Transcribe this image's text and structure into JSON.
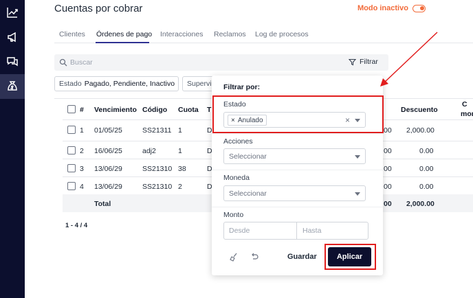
{
  "header": {
    "title": "Cuentas por cobrar",
    "mode_label": "Modo inactivo"
  },
  "sidebar": {
    "items": [
      {
        "icon": "chart-line-icon"
      },
      {
        "icon": "megaphone-icon"
      },
      {
        "icon": "chat-bubbles-icon"
      },
      {
        "icon": "money-bag-icon",
        "active": true
      }
    ]
  },
  "tabs": [
    "Clientes",
    "Órdenes de pago",
    "Interacciones",
    "Reclamos",
    "Log de procesos"
  ],
  "search": {
    "placeholder": "Buscar",
    "filter_label": "Filtrar"
  },
  "chips": [
    {
      "key": "Estado",
      "value": "Pagado, Pendiente, Inactivo"
    },
    {
      "key": "Supervis",
      "value": ""
    }
  ],
  "table": {
    "headers": [
      "#",
      "Vencimiento",
      "Código",
      "Cuota",
      "T",
      "Descuento",
      "C",
      "mon"
    ],
    "rows": [
      {
        "num": "1",
        "vencimiento": "01/05/25",
        "codigo": "SS21311",
        "cuota": "1",
        "t": "D",
        "partial": "00",
        "descuento": "2,000.00"
      },
      {
        "num": "2",
        "vencimiento": "16/06/25",
        "codigo": "adj2",
        "cuota": "1",
        "t": "D",
        "partial": "00",
        "descuento": "0.00"
      },
      {
        "num": "3",
        "vencimiento": "13/06/29",
        "codigo": "SS21310",
        "cuota": "38",
        "t": "D",
        "partial": "00",
        "descuento": "0.00"
      },
      {
        "num": "4",
        "vencimiento": "13/06/29",
        "codigo": "SS21310",
        "cuota": "2",
        "t": "D",
        "partial": "00",
        "descuento": "0.00"
      }
    ],
    "total_label": "Total",
    "total_partial": "00",
    "total_descuento": "2,000.00"
  },
  "pager": "1 - 4 / 4",
  "filter_panel": {
    "title": "Filtrar por:",
    "estado_label": "Estado",
    "estado_tag": "Anulado",
    "acciones_label": "Acciones",
    "acciones_placeholder": "Seleccionar",
    "moneda_label": "Moneda",
    "moneda_placeholder": "Seleccionar",
    "monto_label": "Monto",
    "desde_placeholder": "Desde",
    "hasta_placeholder": "Hasta",
    "save_label": "Guardar",
    "apply_label": "Aplicar"
  },
  "colors": {
    "sidebar_bg": "#0c0f2e",
    "accent": "#2e3192",
    "mode_orange": "#f26b3a",
    "highlight_red": "#e11d1d"
  }
}
